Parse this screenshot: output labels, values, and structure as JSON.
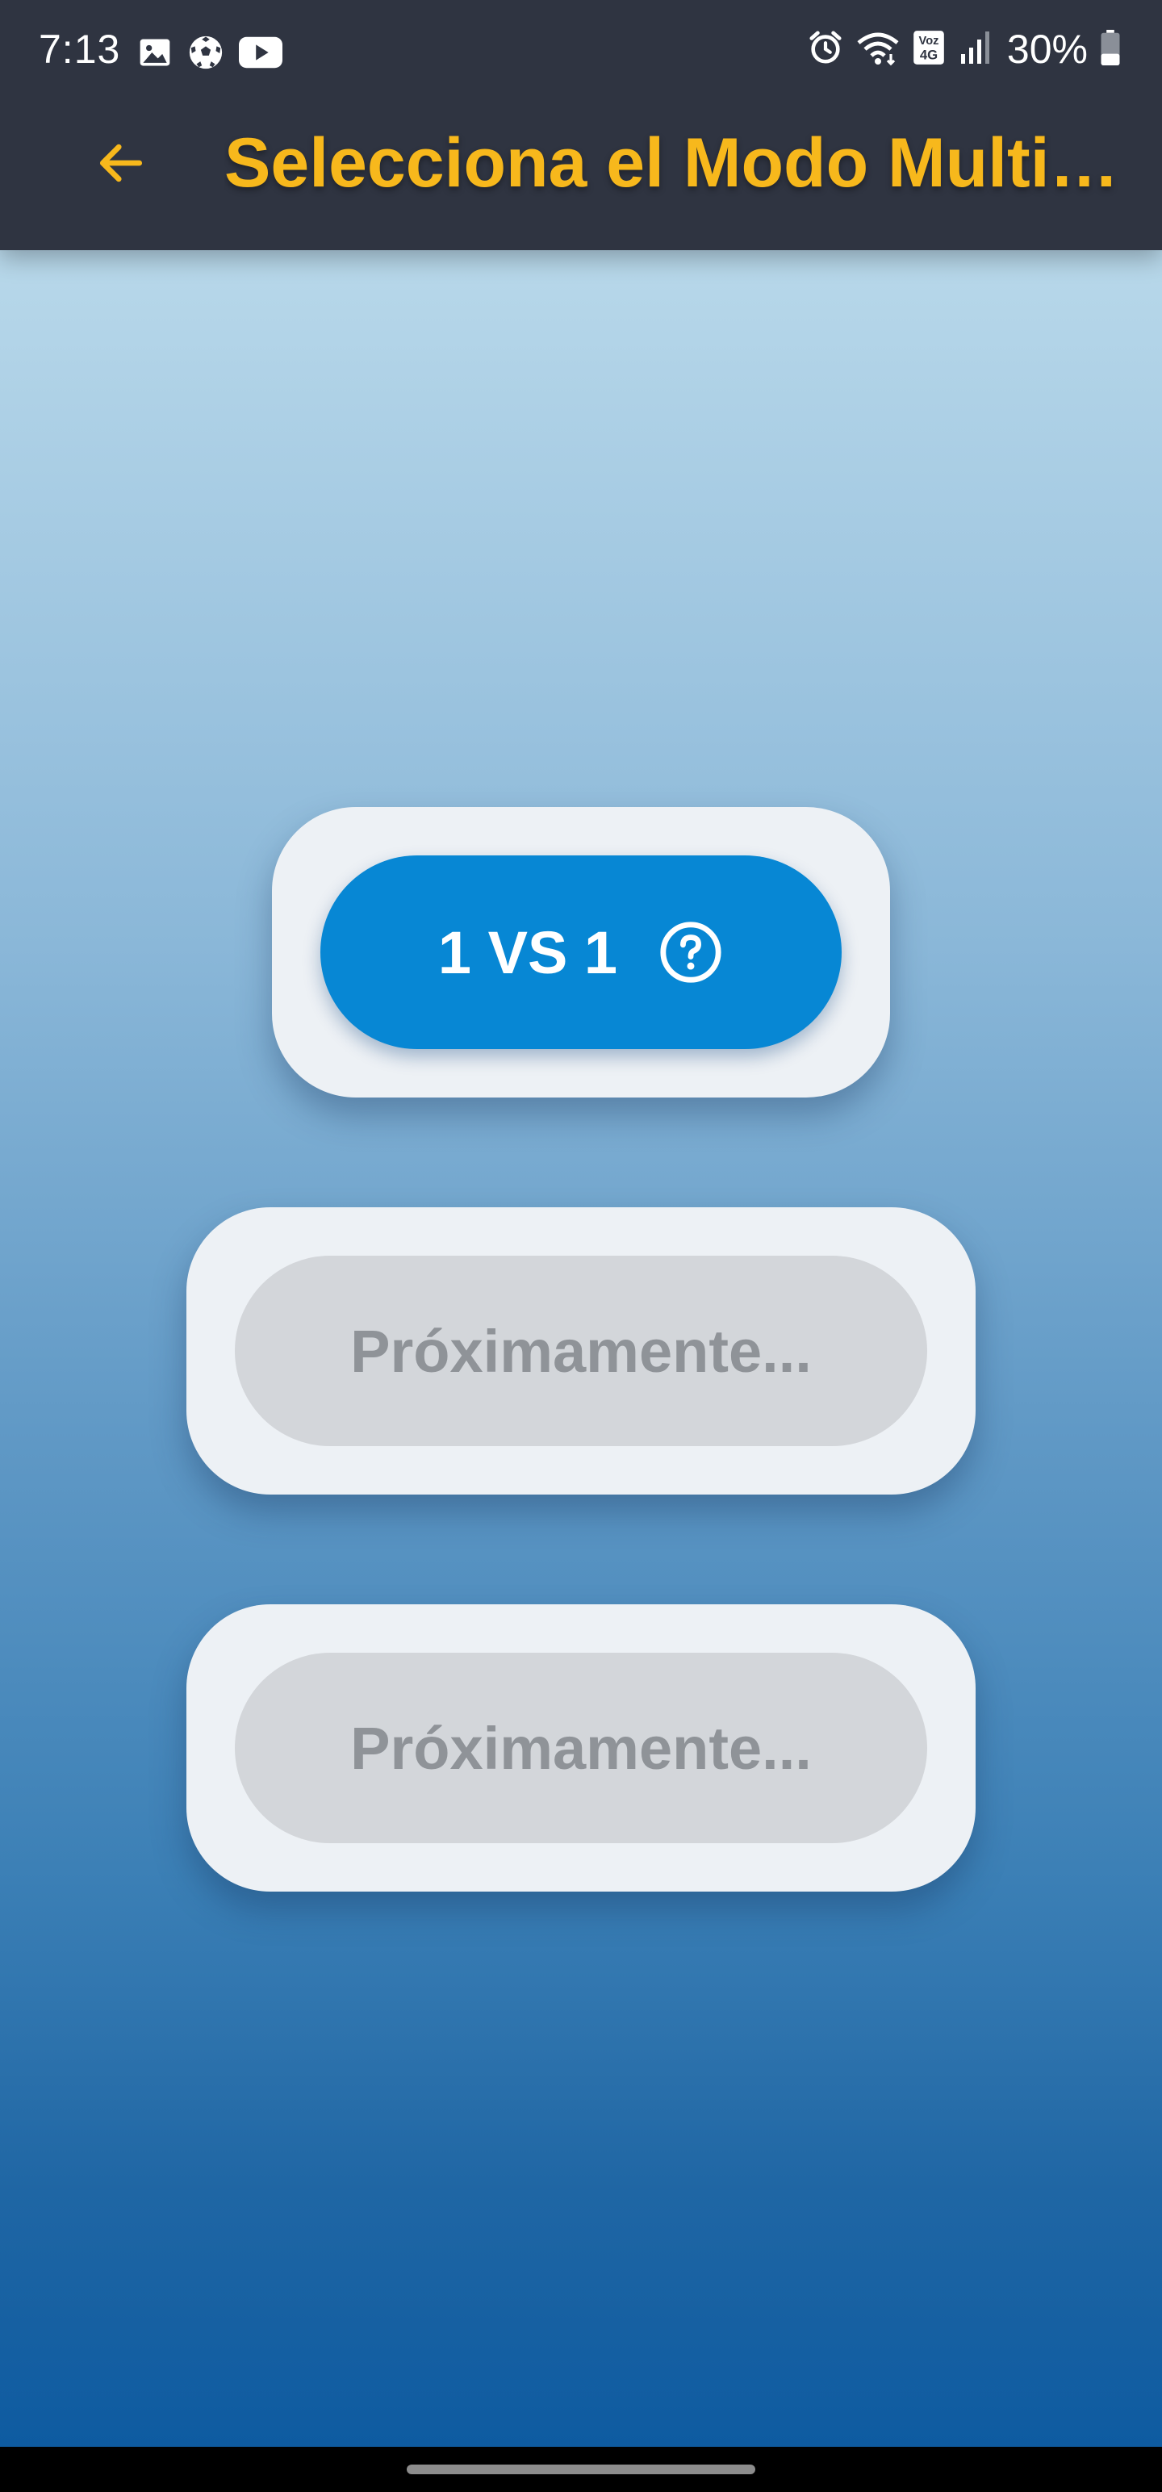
{
  "status_bar": {
    "time": "7:13",
    "battery": "30%",
    "left_icons": [
      "gallery-icon",
      "soccer-ball-icon",
      "youtube-icon"
    ],
    "right_icons": [
      "alarm-icon",
      "wifi-icon",
      "volte-4g-icon",
      "signal-icon",
      "battery-icon"
    ]
  },
  "app_bar": {
    "title": "Selecciona el Modo Multi…",
    "back_icon": "arrow-left-icon",
    "accent_color": "#f7b81c",
    "background_color": "#2f3441"
  },
  "modes": [
    {
      "label": "1 VS 1",
      "enabled": true,
      "icon": "help-circle-icon",
      "color": "#0787d4"
    },
    {
      "label": "Próximamente...",
      "enabled": false,
      "color": "#d3d6da"
    },
    {
      "label": "Próximamente...",
      "enabled": false,
      "color": "#d3d6da"
    }
  ]
}
